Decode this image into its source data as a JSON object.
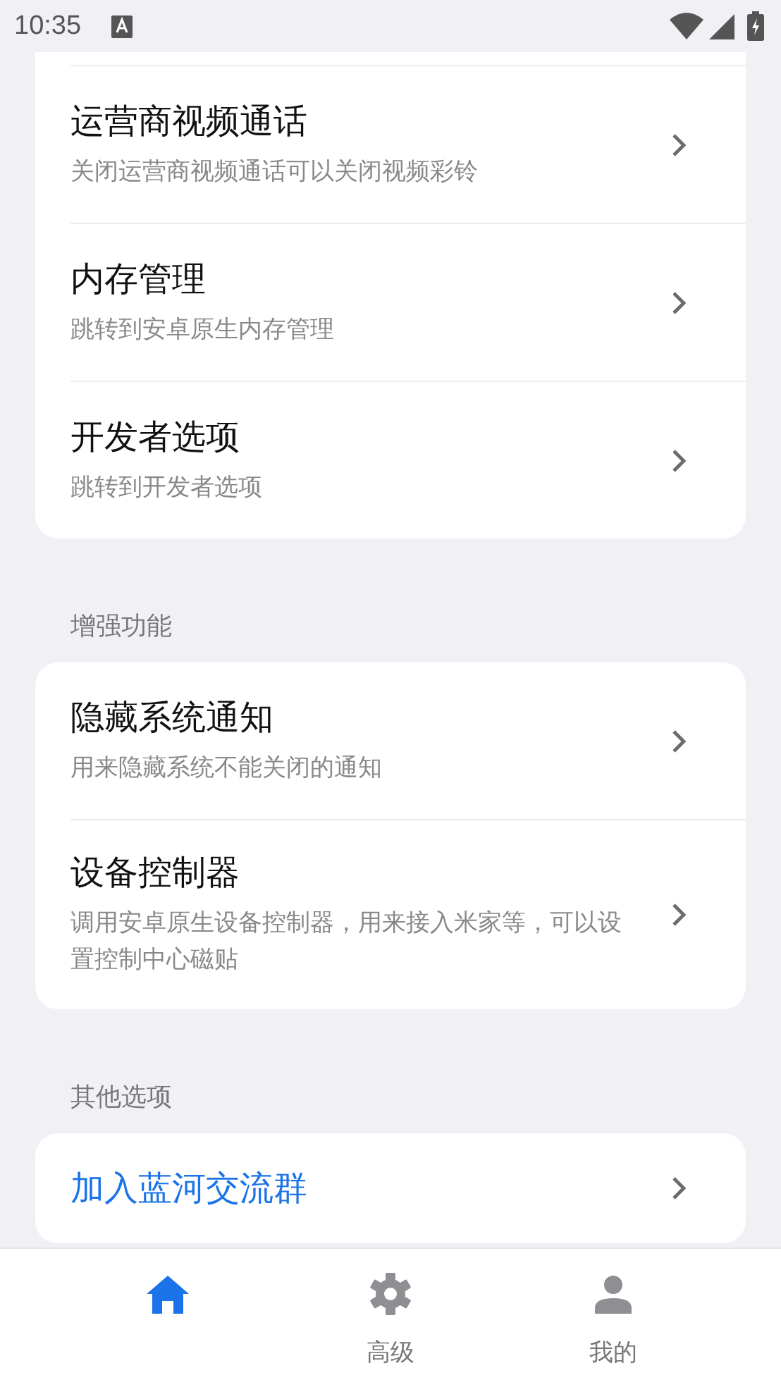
{
  "status_bar": {
    "time": "10:35"
  },
  "sections": [
    {
      "rows": [
        {
          "kind": "nav",
          "title": "运营商视频通话",
          "subtitle": "关闭运营商视频通话可以关闭视频彩铃"
        },
        {
          "kind": "nav",
          "title": "内存管理",
          "subtitle": "跳转到安卓原生内存管理"
        },
        {
          "kind": "nav",
          "title": "开发者选项",
          "subtitle": "跳转到开发者选项"
        }
      ]
    },
    {
      "header": "增强功能",
      "rows": [
        {
          "kind": "nav",
          "title": "隐藏系统通知",
          "subtitle": "用来隐藏系统不能关闭的通知"
        },
        {
          "kind": "nav",
          "title": "设备控制器",
          "subtitle": "调用安卓原生设备控制器，用来接入米家等，可以设置控制中心磁贴"
        }
      ]
    },
    {
      "header": "其他选项",
      "rows": [
        {
          "kind": "link",
          "title": "加入蓝河交流群"
        }
      ]
    }
  ],
  "bottom_nav": [
    {
      "kind": "home",
      "selected": true
    },
    {
      "kind": "gear",
      "label": "高级",
      "selected": false
    },
    {
      "kind": "person",
      "label": "我的",
      "selected": false
    }
  ]
}
